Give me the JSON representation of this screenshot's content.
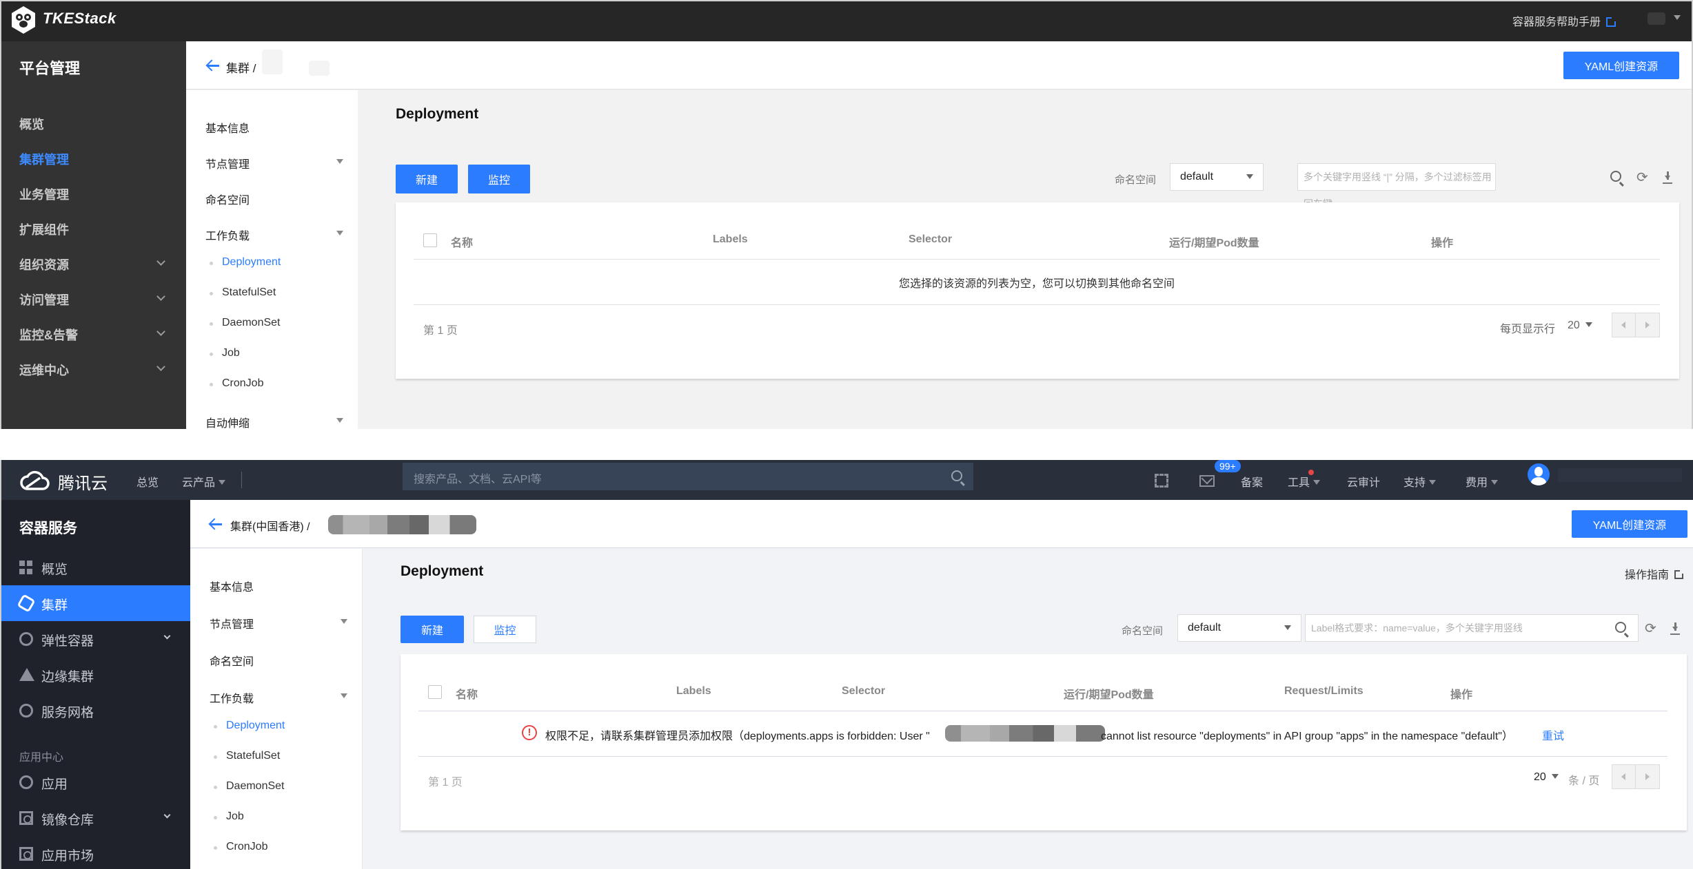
{
  "top_panel": {
    "header": {
      "logo_text": "TKEStack",
      "help_link": "容器服务帮助手册"
    },
    "sidebar": {
      "title": "平台管理",
      "items": [
        {
          "label": "概览",
          "active": false,
          "expandable": false
        },
        {
          "label": "集群管理",
          "active": true,
          "expandable": false
        },
        {
          "label": "业务管理",
          "active": false,
          "expandable": false
        },
        {
          "label": "扩展组件",
          "active": false,
          "expandable": false
        },
        {
          "label": "组织资源",
          "active": false,
          "expandable": true
        },
        {
          "label": "访问管理",
          "active": false,
          "expandable": true
        },
        {
          "label": "监控&告警",
          "active": false,
          "expandable": true
        },
        {
          "label": "运维中心",
          "active": false,
          "expandable": true
        }
      ]
    },
    "breadcrumb": {
      "parent": "集群",
      "separator": "/"
    },
    "yaml_button": "YAML创建资源",
    "subnav": {
      "items": [
        {
          "label": "基本信息",
          "expandable": false
        },
        {
          "label": "节点管理",
          "expandable": true
        },
        {
          "label": "命名空间",
          "expandable": false
        },
        {
          "label": "工作负载",
          "expandable": true
        },
        {
          "label": "自动伸缩",
          "expandable": true
        }
      ],
      "workload_children": [
        "Deployment",
        "StatefulSet",
        "DaemonSet",
        "Job",
        "CronJob"
      ],
      "active_child": "Deployment"
    },
    "main": {
      "title": "Deployment",
      "buttons": {
        "create": "新建",
        "monitor": "监控"
      },
      "namespace_label": "命名空间",
      "namespace_value": "default",
      "search_placeholder": "多个关键字用竖线 “|” 分隔，多个过滤标签用回车键",
      "table": {
        "columns": [
          "名称",
          "Labels",
          "Selector",
          "运行/期望Pod数量",
          "操作"
        ],
        "empty_message": "您选择的该资源的列表为空，您可以切换到其他命名空间"
      },
      "pagination": {
        "page_info": "第 1 页",
        "rows_label": "每页显示行",
        "page_size": "20"
      }
    }
  },
  "bottom_panel": {
    "header": {
      "logo_text": "腾讯云",
      "nav": [
        "总览",
        "云产品"
      ],
      "search_placeholder": "搜索产品、文档、云API等",
      "mail_badge": "99+",
      "links": [
        "备案",
        "工具",
        "云审计",
        "支持",
        "费用"
      ]
    },
    "sidebar": {
      "title": "容器服务",
      "items": [
        {
          "label": "概览",
          "icon": "grid-icon",
          "active": false,
          "expandable": false
        },
        {
          "label": "集群",
          "icon": "cluster-icon",
          "active": true,
          "expandable": false
        },
        {
          "label": "弹性容器",
          "icon": "elastic-container-icon",
          "active": false,
          "expandable": true
        },
        {
          "label": "边缘集群",
          "icon": "edge-cluster-icon",
          "active": false,
          "expandable": false
        },
        {
          "label": "服务网格",
          "icon": "service-mesh-icon",
          "active": false,
          "expandable": false
        }
      ],
      "group_label": "应用中心",
      "group_items": [
        {
          "label": "应用",
          "icon": "app-icon",
          "expandable": false
        },
        {
          "label": "镜像仓库",
          "icon": "image-registry-icon",
          "expandable": true
        },
        {
          "label": "应用市场",
          "icon": "app-market-icon",
          "expandable": false
        }
      ]
    },
    "breadcrumb": {
      "parent": "集群(中国香港)",
      "separator": "/"
    },
    "yaml_button": "YAML创建资源",
    "subnav": {
      "items": [
        {
          "label": "基本信息",
          "expandable": false
        },
        {
          "label": "节点管理",
          "expandable": true
        },
        {
          "label": "命名空间",
          "expandable": false
        },
        {
          "label": "工作负载",
          "expandable": true
        }
      ],
      "workload_children": [
        "Deployment",
        "StatefulSet",
        "DaemonSet",
        "Job",
        "CronJob"
      ],
      "active_child": "Deployment"
    },
    "main": {
      "title": "Deployment",
      "guide_link": "操作指南",
      "buttons": {
        "create": "新建",
        "monitor": "监控"
      },
      "namespace_label": "命名空间",
      "namespace_value": "default",
      "search_placeholder": "Label格式要求：name=value，多个关键字用竖线",
      "table": {
        "columns": [
          "名称",
          "Labels",
          "Selector",
          "运行/期望Pod数量",
          "Request/Limits",
          "操作"
        ],
        "error_prefix": "权限不足，请联系集群管理员添加权限（deployments.apps is forbidden: User \"",
        "error_suffix": "cannot list resource \"deployments\" in API group \"apps\" in the namespace \"default\"）",
        "retry_label": "重试"
      },
      "pagination": {
        "page_info": "第 1 页",
        "page_size": "20",
        "per_page_label": "条 / 页"
      }
    }
  },
  "colors": {
    "accent": "#2b7cff",
    "error": "#e54545",
    "top_header_bg": "#262626",
    "top_sidebar_bg": "#333333",
    "bottom_header_bg": "#292f3b",
    "bottom_sidebar_bg": "#1f222b"
  }
}
